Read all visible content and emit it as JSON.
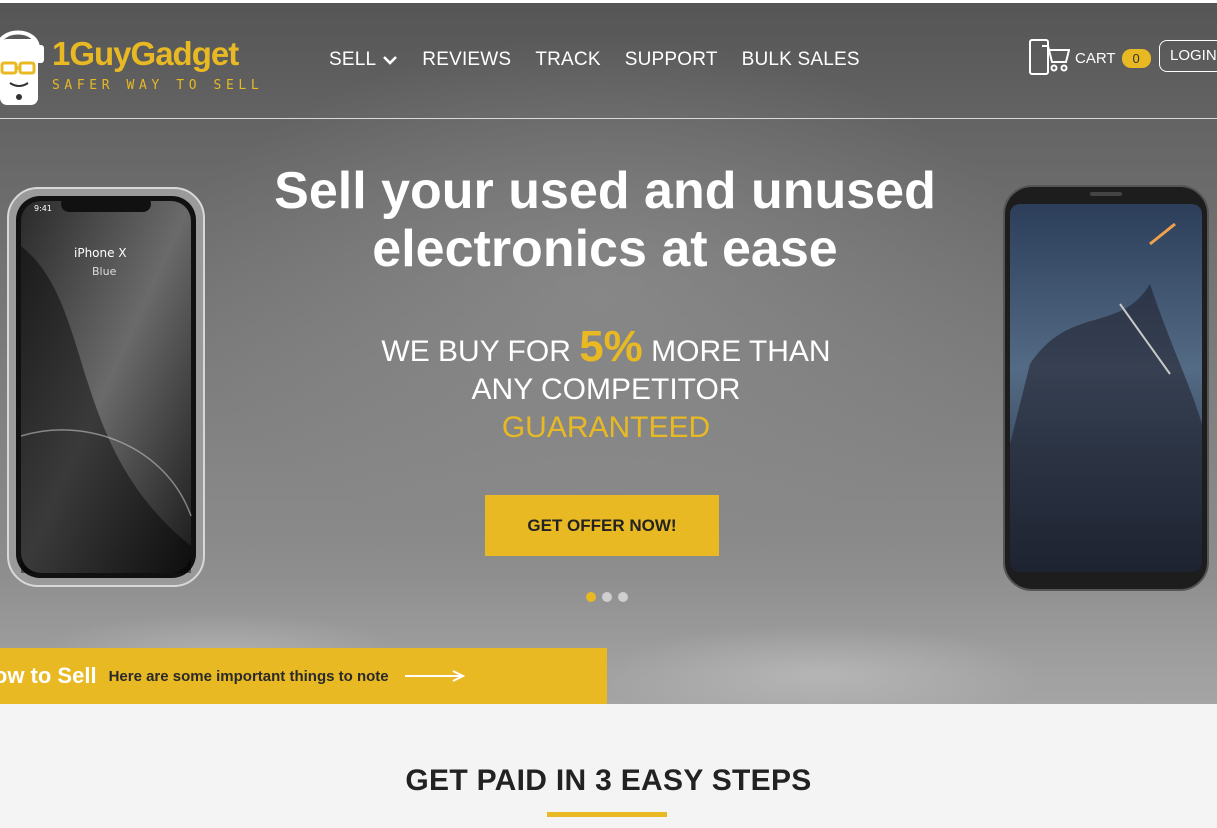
{
  "header": {
    "brand": {
      "name": "1GuyGadget",
      "tagline": "SAFER WAY TO SELL"
    },
    "nav": [
      {
        "label": "SELL",
        "has_dropdown": true
      },
      {
        "label": "REVIEWS"
      },
      {
        "label": "TRACK"
      },
      {
        "label": "SUPPORT"
      },
      {
        "label": "BULK SALES"
      }
    ],
    "cart": {
      "label": "CART",
      "count": "0"
    },
    "login_label": "LOGIN"
  },
  "hero": {
    "title_line1": "Sell your used and unused",
    "title_line2": "electronics at ease",
    "offer": {
      "prefix": "WE BUY FOR",
      "percent": "5%",
      "suffix": "MORE THAN",
      "line2": "ANY COMPETITOR",
      "line3": "GUARANTEED"
    },
    "cta_label": "GET OFFER NOW!",
    "slides": {
      "count": 3,
      "active": 1
    },
    "phone_left": {
      "time": "9:41",
      "model": "iPhone X",
      "color": "Blue"
    }
  },
  "howto": {
    "title": "How to Sell",
    "subtitle": "Here are some important things to note"
  },
  "steps": {
    "title": "GET PAID IN 3 EASY STEPS"
  },
  "colors": {
    "accent": "#e8b923",
    "text_dark": "#222222",
    "page_bg": "#f4f4f4"
  },
  "icons": [
    "logo-guy-icon",
    "chevron-down-icon",
    "cart-icon",
    "arrow-right-icon"
  ]
}
